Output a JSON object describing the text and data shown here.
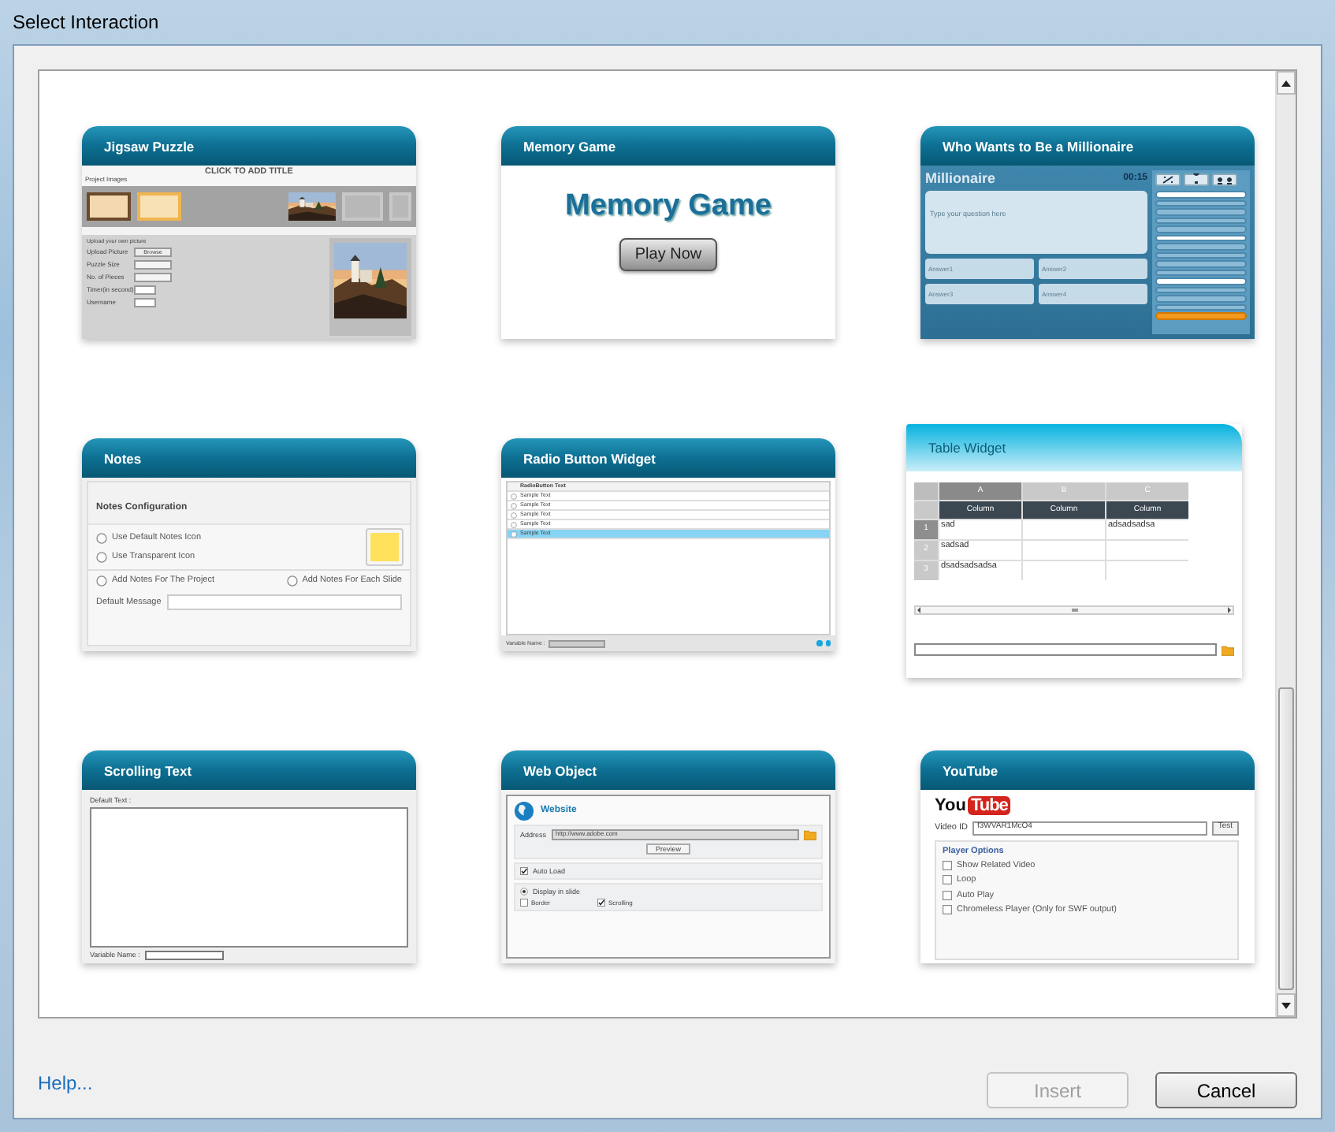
{
  "window": {
    "title": "Select Interaction"
  },
  "interactions": [
    {
      "kind": "jigsaw",
      "title": "Jigsaw Puzzle",
      "heading": "CLICK TO ADD TITLE",
      "section": "Project Images",
      "caption": "Upload your own picture",
      "fields": [
        {
          "label": "Upload Picture",
          "kind": "button",
          "value": "Browse"
        },
        {
          "label": "Puzzle Size",
          "kind": "select"
        },
        {
          "label": "No. of Pieces",
          "kind": "select"
        },
        {
          "label": "Timer(in second)",
          "kind": "input"
        },
        {
          "label": "Username",
          "kind": "input"
        }
      ]
    },
    {
      "kind": "memory",
      "title": "Memory Game",
      "heading": "Memory Game",
      "button": "Play Now"
    },
    {
      "kind": "millionaire",
      "title": "Who Wants to Be a Millionaire",
      "game": "Millionaire",
      "timer": "00:15",
      "question": "Type your question here",
      "answers": [
        "Answer1",
        "Answer2",
        "Answer3",
        "Answer4"
      ],
      "ladder": [
        {
          "kind": "milestone"
        },
        {
          "kind": "plain"
        },
        {
          "kind": "plain"
        },
        {
          "kind": "plain"
        },
        {
          "kind": "plain"
        },
        {
          "kind": "milestone"
        },
        {
          "kind": "plain"
        },
        {
          "kind": "plain"
        },
        {
          "kind": "plain"
        },
        {
          "kind": "plain"
        },
        {
          "kind": "milestone"
        },
        {
          "kind": "plain"
        },
        {
          "kind": "plain"
        },
        {
          "kind": "plain"
        },
        {
          "kind": "current"
        }
      ]
    },
    {
      "kind": "notes",
      "title": "Notes",
      "heading": "Notes Configuration",
      "icon_options": [
        {
          "label": "Use Default Notes Icon",
          "selected": false
        },
        {
          "label": "Use Transparent Icon",
          "selected": false
        }
      ],
      "scope_options": [
        {
          "label": "Add Notes For The Project",
          "selected": false
        },
        {
          "label": "Add Notes For Each Slide",
          "selected": false
        }
      ],
      "message_label": "Default Message"
    },
    {
      "kind": "radio",
      "title": "Radio Button Widget",
      "column": "RadioButton Text",
      "rows": [
        {
          "label": "Sample Text",
          "selected": false
        },
        {
          "label": "Sample Text",
          "selected": false
        },
        {
          "label": "Sample Text",
          "selected": false
        },
        {
          "label": "Sample Text",
          "selected": false
        },
        {
          "label": "Sample Text",
          "selected": true
        }
      ],
      "variable_label": "Variable Name :"
    },
    {
      "kind": "table",
      "title": "Table Widget",
      "letters": [
        "A",
        "B",
        "C"
      ],
      "columns": [
        "Column",
        "Column",
        "Column"
      ],
      "rows": [
        {
          "number": "1",
          "cells": [
            "sad",
            "",
            "adsadsadsa"
          ]
        },
        {
          "number": "2",
          "cells": [
            "sadsad",
            "",
            ""
          ]
        },
        {
          "number": "3",
          "cells": [
            "dsadsadsadsa",
            "",
            ""
          ]
        }
      ]
    },
    {
      "kind": "scrolling",
      "title": "Scrolling Text",
      "text_label": "Default Text :",
      "variable_label": "Variable Name :"
    },
    {
      "kind": "web",
      "title": "Web Object",
      "heading": "Website",
      "address_label": "Address",
      "address": "http://www.adobe.com",
      "button": "Preview",
      "auto_load": {
        "label": "Auto Load",
        "checked": true
      },
      "display": {
        "label": "Display in slide",
        "selected": true
      },
      "options": [
        {
          "label": "Border",
          "checked": false
        },
        {
          "label": "Scrolling",
          "checked": true
        }
      ]
    },
    {
      "kind": "youtube",
      "title": "YouTube",
      "logo": [
        "You",
        "Tube"
      ],
      "id_label": "Video ID",
      "video_id": "f3WVAR1McO4",
      "button": "Test",
      "options_title": "Player Options",
      "options": [
        {
          "label": "Show Related Video",
          "checked": false
        },
        {
          "label": "Loop",
          "checked": false
        },
        {
          "label": "Auto Play",
          "checked": false
        },
        {
          "label": "Chromeless Player (Only for SWF output)",
          "checked": false
        }
      ]
    }
  ],
  "footer": {
    "help": "Help...",
    "buttons": [
      {
        "label": "Insert",
        "disabled": true
      },
      {
        "label": "Cancel",
        "disabled": false
      }
    ]
  }
}
